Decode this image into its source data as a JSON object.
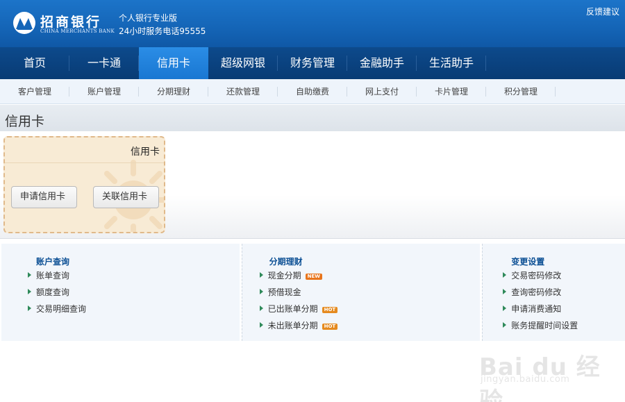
{
  "header": {
    "logo_cn": "招商银行",
    "logo_en": "CHINA MERCHANTS BANK",
    "slogan_line1": "个人银行专业版",
    "slogan_line2": "24小时服务电话95555",
    "feedback": "反馈建议"
  },
  "main_nav": [
    "首页",
    "一卡通",
    "信用卡",
    "超级网银",
    "财务管理",
    "金融助手",
    "生活助手"
  ],
  "main_nav_active": "信用卡",
  "sub_nav": [
    "客户管理",
    "账户管理",
    "分期理财",
    "还款管理",
    "自助缴费",
    "网上支付",
    "卡片管理",
    "积分管理"
  ],
  "page_title": "信用卡",
  "card": {
    "title": "信用卡",
    "apply_button": "申请信用卡",
    "link_button": "关联信用卡"
  },
  "panels": [
    {
      "title": "账户查询",
      "items": [
        {
          "label": "账单查询"
        },
        {
          "label": "额度查询"
        },
        {
          "label": "交易明细查询"
        }
      ]
    },
    {
      "title": "分期理财",
      "items": [
        {
          "label": "现金分期",
          "badge": "NEW"
        },
        {
          "label": "预借现金"
        },
        {
          "label": "已出账单分期",
          "badge": "HOT"
        },
        {
          "label": "未出账单分期",
          "badge": "HOT"
        }
      ]
    },
    {
      "title": "变更设置",
      "items": [
        {
          "label": "交易密码修改"
        },
        {
          "label": "查询密码修改"
        },
        {
          "label": "申请消费通知"
        },
        {
          "label": "账务提醒时间设置"
        }
      ]
    }
  ],
  "watermark": {
    "text": "Bai du 经验",
    "url": "jingyan.baidu.com"
  },
  "colors": {
    "header_blue": "#1566b8",
    "nav_dark": "#0a4380",
    "nav_active": "#2186dd",
    "panel_title": "#0b4f94",
    "card_bg": "#f8ebd5",
    "badge_orange": "#e8751c"
  }
}
